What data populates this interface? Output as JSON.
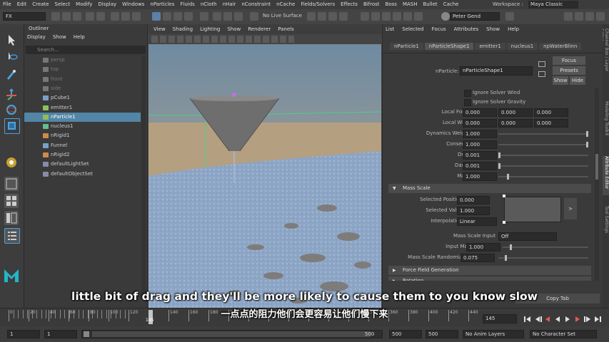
{
  "menubar": {
    "items": [
      "File",
      "Edit",
      "Create",
      "Select",
      "Modify",
      "Display",
      "Windows",
      "nParticles",
      "Fluids",
      "nCloth",
      "nHair",
      "nConstraint",
      "nCache",
      "Fields/Solvers",
      "Effects",
      "Bifrost",
      "Boss",
      "MASH",
      "Bullet",
      "Cache"
    ],
    "workspace_label": "Workspace :",
    "workspace_value": "Maya Classic"
  },
  "statusbar": {
    "menuset": "FX",
    "live_surface": "No Live Surface",
    "user": "Peter Gend"
  },
  "outliner": {
    "title": "Outliner",
    "menu": [
      "Display",
      "Show",
      "Help"
    ],
    "search_placeholder": "Search...",
    "items": [
      {
        "label": "persp",
        "dim": true,
        "color": "#777"
      },
      {
        "label": "top",
        "dim": true,
        "color": "#777"
      },
      {
        "label": "front",
        "dim": true,
        "color": "#777"
      },
      {
        "label": "side",
        "dim": true,
        "color": "#777"
      },
      {
        "label": "pCube1",
        "dim": false,
        "color": "#7aa0c8"
      },
      {
        "label": "emitter1",
        "dim": false,
        "color": "#8fbf5a"
      },
      {
        "label": "nParticle1",
        "dim": false,
        "color": "#8fbf5a",
        "selected": true
      },
      {
        "label": "nucleus1",
        "dim": false,
        "color": "#5fbf8f"
      },
      {
        "label": "nRigid1",
        "dim": false,
        "color": "#d08a4a"
      },
      {
        "label": "Funnel",
        "dim": false,
        "color": "#7aa0c8"
      },
      {
        "label": "nRigid2",
        "dim": false,
        "color": "#d08a4a"
      },
      {
        "label": "defaultLightSet",
        "dim": false,
        "color": "#8a8aa8"
      },
      {
        "label": "defaultObjectSet",
        "dim": false,
        "color": "#8a8aa8"
      }
    ]
  },
  "viewport": {
    "menu": [
      "View",
      "Shading",
      "Lighting",
      "Show",
      "Renderer",
      "Panels"
    ]
  },
  "attribute_editor": {
    "menu": [
      "List",
      "Selected",
      "Focus",
      "Attributes",
      "Show",
      "Help"
    ],
    "tabs": [
      "nParticle1",
      "nParticleShape1",
      "emitter1",
      "nucleus1",
      "npWaterBlinn"
    ],
    "node_label": "nParticle:",
    "node_value": "nParticleShape1",
    "buttons": {
      "focus": "Focus",
      "presets": "Presets",
      "show": "Show",
      "hide": "Hide",
      "copy_tab": "Copy Tab"
    },
    "checkboxes": [
      "Ignore Solver Wind",
      "Ignore Solver Gravity"
    ],
    "vector_rows": [
      {
        "label": "Local Force",
        "values": [
          "0.000",
          "0.000",
          "0.000"
        ]
      },
      {
        "label": "Local Wind",
        "values": [
          "0.000",
          "0.000",
          "0.000"
        ]
      }
    ],
    "scalar_rows": [
      {
        "label": "Dynamics Weight",
        "value": "1.000",
        "fraction": 1.0
      },
      {
        "label": "Conserve",
        "value": "1.000",
        "fraction": 1.0
      },
      {
        "label": "Drag",
        "value": "0.001",
        "fraction": 0.0
      },
      {
        "label": "Damp",
        "value": "0.001",
        "fraction": 0.0
      },
      {
        "label": "Mass",
        "value": "1.000",
        "fraction": 0.1
      }
    ],
    "mass_scale": {
      "title": "Mass Scale",
      "selected_position_label": "Selected Position",
      "selected_position": "0.000",
      "selected_value_label": "Selected Value",
      "selected_value": "1.000",
      "interpolation_label": "Interpolation",
      "interpolation": "Linear",
      "input_label": "Mass Scale Input",
      "input_value": "Off",
      "input_max_label": "Input Max",
      "input_max": "1.000",
      "randomize_label": "Mass Scale Randomize",
      "randomize": "0.075"
    },
    "collapsed_sections": [
      "Force Field Generation",
      "Rotation"
    ]
  },
  "right_tabs": [
    "Channel Box / Layer Editor",
    "Modeling Toolkit",
    "Attribute Editor",
    "Tool Settings"
  ],
  "timeline": {
    "ticks": [
      "0",
      "20",
      "40",
      "60",
      "80",
      "100",
      "120",
      "140",
      "160",
      "180",
      "200",
      "220",
      "240",
      "260",
      "280",
      "300",
      "320",
      "340",
      "360",
      "380",
      "400",
      "420",
      "440",
      "460",
      "480",
      "500"
    ],
    "current_frame": "145",
    "frame_field": "145"
  },
  "range": {
    "start": "1",
    "start2": "1",
    "range_end": "500",
    "end": "500",
    "end2": "500",
    "anim_layers": "No Anim Layers",
    "character_set": "No Character Set"
  },
  "subtitles": {
    "english": "little bit of drag and they'll be more likely to cause them to you know slow",
    "chinese": "一点点的阻力他们会更容易让他们慢下来"
  }
}
